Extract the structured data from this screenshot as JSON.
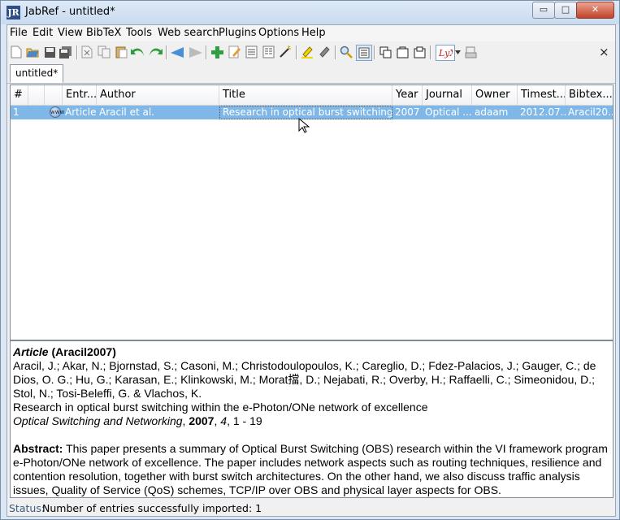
{
  "window": {
    "title": "JabRef - untitled*",
    "app_icon_text": "JR",
    "min_glyph": "▭",
    "max_glyph": "□",
    "close_glyph": "✕"
  },
  "menu": [
    "File",
    "Edit",
    "View",
    "BibTeX",
    "Tools",
    "Web search",
    "Plugins",
    "Options",
    "Help"
  ],
  "toolbar": {
    "icons": [
      "new-database-icon",
      "open-folder-icon",
      "save-icon",
      "save-all-icon",
      "cut-icon",
      "copy-icon",
      "paste-icon",
      "undo-icon",
      "redo-icon",
      "back-icon",
      "forward-icon",
      "add-entry-icon",
      "edit-entry-icon",
      "edit-preamble-icon",
      "edit-strings-icon",
      "cleanup-wand-icon",
      "mark-entries-icon",
      "unmark-entries-icon",
      "search-icon",
      "toggle-preview-icon",
      "open-pdf-icon",
      "open-url-icon",
      "open-file-icon",
      "lyx-icon",
      "push-dropdown-icon",
      "send-to-printer-icon"
    ],
    "close_glyph": "×"
  },
  "tabs": [
    {
      "label": "untitled*"
    }
  ],
  "table": {
    "columns": [
      "#",
      "",
      "",
      "Entr...",
      "Author",
      "Title",
      "Year",
      "Journal",
      "Owner",
      "Timest...",
      "Bibtex..."
    ],
    "rows": [
      {
        "num": "1",
        "type": "Article",
        "author": "Aracil et al.",
        "title": "Research in optical burst switching ...",
        "year": "2007",
        "journal": "Optical ...",
        "owner": "adaam",
        "timestamp": "2012.07....",
        "bibtexkey": "Aracil20..."
      }
    ],
    "row_highlight": "#7fb8e8"
  },
  "preview": {
    "type": "Article",
    "key_open": "(",
    "key": "Aracil2007",
    "key_close": ")",
    "authors": "Aracil, J.; Akar, N.; Bjornstad, S.; Casoni, M.; Christodoulopoulos, K.; Careglio, D.; Fdez-Palacios, J.; Gauger, C.; de Dios, O. G.; Hu, G.; Karasan, E.; Klinkowski, M.; Morat擋, D.; Nejabati, R.; Overby, H.; Raffaelli, C.; Simeonidou, D.; Stol, N.; Tosi-Beleffi, G. & Vlachos, K.",
    "title": "Research in optical burst switching within the e-Photon/ONe network of excellence",
    "journal": "Optical Switching and Networking",
    "year": "2007",
    "volume": "4",
    "pages": "1 - 19",
    "abstract_label": "Abstract:",
    "abstract": "This paper presents a summary of Optical Burst Switching (OBS) research within the VI framework program e-Photon/ONe network of excellence. The paper includes network aspects such as routing techniques, resilience and contention resolution, together with burst switch architectures. On the other hand, we also discuss traffic analysis issues, Quality of Service (QoS) schemes, TCP/IP over OBS and physical layer aspects for OBS."
  },
  "status": {
    "label": "Status:",
    "text": "Number of entries successfully imported: 1"
  }
}
